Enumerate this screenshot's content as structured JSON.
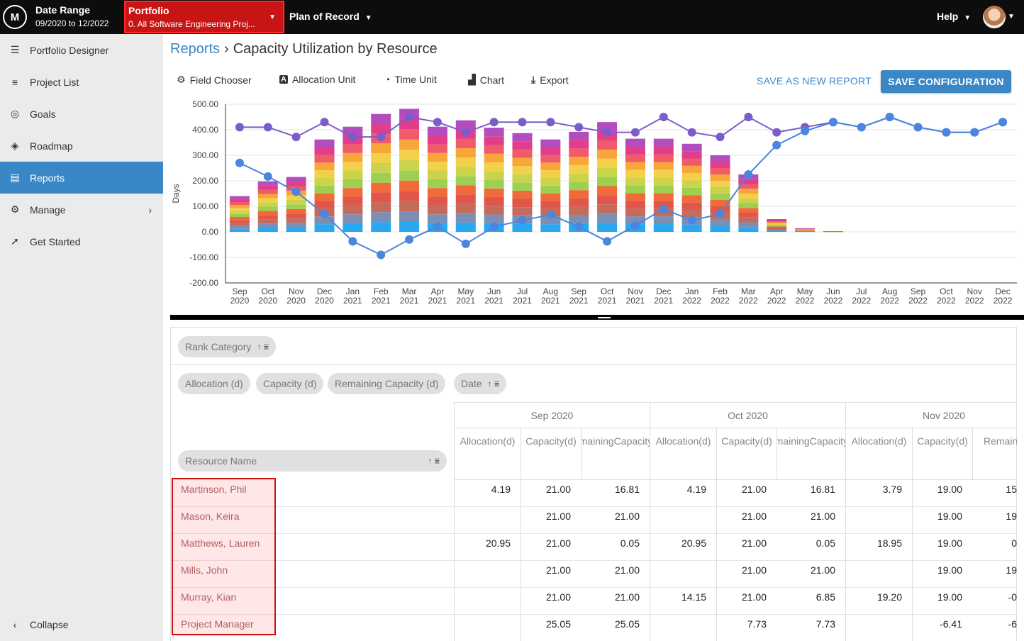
{
  "topbar": {
    "logo": "M",
    "date_range_label": "Date Range",
    "date_range_value": "09/2020 to 12/2022",
    "portfolio_label": "Portfolio",
    "portfolio_value": "0. All Software Engineering Proj...",
    "plan_label": "Plan of Record",
    "help_label": "Help",
    "accent": "#c81414"
  },
  "sidebar": {
    "items": [
      {
        "label": "Portfolio Designer",
        "icon": "portfolio-designer-icon"
      },
      {
        "label": "Project List",
        "icon": "list-icon"
      },
      {
        "label": "Goals",
        "icon": "target-icon"
      },
      {
        "label": "Roadmap",
        "icon": "roadmap-icon"
      },
      {
        "label": "Reports",
        "icon": "report-icon",
        "active": true
      },
      {
        "label": "Manage",
        "icon": "gear-icon"
      },
      {
        "label": "Get Started",
        "icon": "compass-icon"
      }
    ],
    "collapse_label": "Collapse",
    "active_color": "#3a87c7"
  },
  "header": {
    "breadcrumb_link": "Reports",
    "breadcrumb_sep": "›",
    "title": "Capacity Utilization by Resource"
  },
  "toolbar": {
    "field_chooser": "Field Chooser",
    "allocation_unit": "Allocation Unit",
    "time_unit": "Time Unit",
    "chart": "Chart",
    "export": "Export",
    "save_as_new": "SAVE AS NEW REPORT",
    "save_config": "SAVE CONFIGURATION"
  },
  "chart_data": {
    "type": "bar",
    "ylabel": "Days",
    "ylim": [
      -200,
      500
    ],
    "yticks": [
      "500.00",
      "400.00",
      "300.00",
      "200.00",
      "100.00",
      "0.00",
      "-100.00",
      "-200.00"
    ],
    "grid": true,
    "categories": [
      [
        "Sep",
        "2020"
      ],
      [
        "Oct",
        "2020"
      ],
      [
        "Nov",
        "2020"
      ],
      [
        "Dec",
        "2020"
      ],
      [
        "Jan",
        "2021"
      ],
      [
        "Feb",
        "2021"
      ],
      [
        "Mar",
        "2021"
      ],
      [
        "Apr",
        "2021"
      ],
      [
        "May",
        "2021"
      ],
      [
        "Jun",
        "2021"
      ],
      [
        "Jul",
        "2021"
      ],
      [
        "Aug",
        "2021"
      ],
      [
        "Sep",
        "2021"
      ],
      [
        "Oct",
        "2021"
      ],
      [
        "Nov",
        "2021"
      ],
      [
        "Dec",
        "2021"
      ],
      [
        "Jan",
        "2022"
      ],
      [
        "Feb",
        "2022"
      ],
      [
        "Mar",
        "2022"
      ],
      [
        "Apr",
        "2022"
      ],
      [
        "May",
        "2022"
      ],
      [
        "Jun",
        "2022"
      ],
      [
        "Jul",
        "2022"
      ],
      [
        "Aug",
        "2022"
      ],
      [
        "Sep",
        "2022"
      ],
      [
        "Oct",
        "2022"
      ],
      [
        "Nov",
        "2022"
      ],
      [
        "Dec",
        "2022"
      ]
    ],
    "stacked_totals": [
      140,
      198,
      215,
      362,
      412,
      462,
      482,
      412,
      437,
      408,
      387,
      362,
      392,
      430,
      365,
      365,
      345,
      300,
      225,
      50,
      14,
      2,
      0,
      0,
      0,
      0,
      0,
      0
    ],
    "stack_colors": [
      "#29a8f0",
      "#7b8fb5",
      "#c56b5b",
      "#e0564a",
      "#f06a3a",
      "#9fcf50",
      "#c9d44a",
      "#f4d04a",
      "#f7a63a",
      "#f05a6a",
      "#e23d8a",
      "#b24dbd"
    ],
    "lines": [
      {
        "name": "Capacity",
        "color": "#7b5cc9",
        "values": [
          410,
          410,
          372,
          430,
          372,
          372,
          450,
          430,
          390,
          430,
          430,
          430,
          410,
          390,
          390,
          450,
          390,
          372,
          450,
          390,
          410,
          430,
          410,
          450,
          410,
          390,
          390,
          430
        ]
      },
      {
        "name": "Remaining Capacity",
        "color": "#4a86dd",
        "values": [
          270,
          217,
          157,
          70,
          -37,
          -90,
          -30,
          20,
          -47,
          20,
          45,
          67,
          20,
          -37,
          25,
          90,
          45,
          70,
          225,
          340,
          395,
          430,
          410,
          450,
          410,
          390,
          390,
          430
        ]
      }
    ]
  },
  "pivot": {
    "filter_chip": "Rank Category",
    "value_chips": [
      "Allocation (d)",
      "Capacity (d)",
      "Remaining Capacity (d)"
    ],
    "column_chip": "Date",
    "row_chip": "Resource Name",
    "months": [
      "Sep 2020",
      "Oct 2020",
      "Nov 2020"
    ],
    "subheaders": [
      [
        "Allocation",
        "(d)"
      ],
      [
        "Capacity",
        "(d)"
      ],
      [
        "Remaining",
        "Capacity",
        "(d)"
      ]
    ],
    "rows": [
      {
        "name": "Martinson, Phil",
        "values": [
          "4.19",
          "21.00",
          "16.81",
          "4.19",
          "21.00",
          "16.81",
          "3.79",
          "19.00",
          "15"
        ]
      },
      {
        "name": "Mason, Keira",
        "values": [
          "",
          "21.00",
          "21.00",
          "",
          "21.00",
          "21.00",
          "",
          "19.00",
          "19"
        ]
      },
      {
        "name": "Matthews, Lauren",
        "values": [
          "20.95",
          "21.00",
          "0.05",
          "20.95",
          "21.00",
          "0.05",
          "18.95",
          "19.00",
          "0"
        ]
      },
      {
        "name": "Mills, John",
        "values": [
          "",
          "21.00",
          "21.00",
          "",
          "21.00",
          "21.00",
          "",
          "19.00",
          "19"
        ]
      },
      {
        "name": "Murray, Kian",
        "values": [
          "",
          "21.00",
          "21.00",
          "14.15",
          "21.00",
          "6.85",
          "19.20",
          "19.00",
          "-0"
        ]
      },
      {
        "name": "Project Manager",
        "values": [
          "",
          "25.05",
          "25.05",
          "",
          "7.73",
          "7.73",
          "",
          "-6.41",
          "-6"
        ]
      }
    ]
  }
}
